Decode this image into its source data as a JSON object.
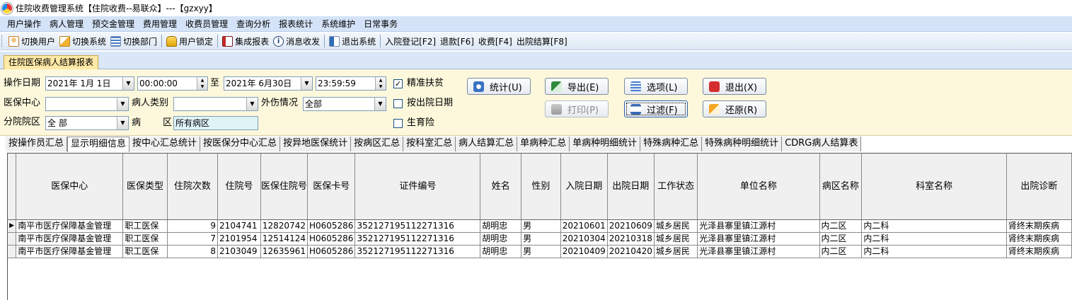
{
  "window": {
    "title": "住院收费管理系统【住院收费--易联众】---【gzxyy】"
  },
  "menu": [
    "用户操作",
    "病人管理",
    "预交金管理",
    "费用管理",
    "收费员管理",
    "查询分析",
    "报表统计",
    "系统维护",
    "日常事务"
  ],
  "toolbar": {
    "switch_user": "切换用户",
    "switch_system": "切换系统",
    "switch_dept": "切换部门",
    "lock_user": "用户锁定",
    "integrated_report": "集成报表",
    "message": "消息收发",
    "exit_system": "退出系统",
    "admission": "入院登记[F2]",
    "refund": "退款[F6]",
    "charge": "收费[F4]",
    "discharge": "出院结算[F8]"
  },
  "doc_tab": "住院医保病人结算报表",
  "filters": {
    "op_date_label": "操作日期",
    "date_from": "2021年 1月 1日",
    "time_from": "00:00:00",
    "to_label": "至",
    "date_to": "2021年 6月30日",
    "time_to": "23:59:59",
    "precise_poverty": {
      "label": "精准扶贫",
      "checked": "✓"
    },
    "by_discharge_date": {
      "label": "按出院日期",
      "checked": ""
    },
    "maternity": {
      "label": "生育险",
      "checked": ""
    },
    "insurance_center_label": "医保中心",
    "insurance_center_value": "",
    "patient_type_label": "病人类别",
    "patient_type_value": "",
    "injury_label": "外伤情况",
    "injury_value": "全部",
    "branch_label": "分院院区",
    "branch_value": "全 部",
    "ward_label_1": "病",
    "ward_label_2": "区",
    "ward_value": "所有病区"
  },
  "buttons": {
    "stat": "统计(U)",
    "export": "导出(E)",
    "options": "选项(L)",
    "exit": "退出(X)",
    "print": "打印(P)",
    "filter": "过滤(F)",
    "restore": "还原(R)"
  },
  "subtabs": [
    "按操作员汇总",
    "显示明细信息",
    "按中心汇总统计",
    "按医保分中心汇总",
    "按异地医保统计",
    "按病区汇总",
    "按科室汇总",
    "病人结算汇总",
    "单病种汇总",
    "单病种明细统计",
    "特殊病种汇总",
    "特殊病种明细统计",
    "CDRG病人结算表"
  ],
  "table": {
    "columns": [
      "医保中心",
      "医保类型",
      "住院次数",
      "住院号",
      "医保住院号",
      "医保卡号",
      "证件编号",
      "姓名",
      "性别",
      "入院日期",
      "出院日期",
      "工作状态",
      "单位名称",
      "病区名称",
      "科室名称",
      "出院诊断"
    ],
    "rows": [
      [
        "南平市医疗保障基金管理",
        "职工医保",
        "9",
        "2104741",
        "12820742",
        "H0605286",
        "352127195112271316",
        "胡明忠",
        "男",
        "20210601",
        "20210609",
        "城乡居民",
        "光泽县寨里镇江源村",
        "内二区",
        "内二科",
        "肾终末期疾病"
      ],
      [
        "南平市医疗保障基金管理",
        "职工医保",
        "7",
        "2101954",
        "12514124",
        "H0605286",
        "352127195112271316",
        "胡明忠",
        "男",
        "20210304",
        "20210318",
        "城乡居民",
        "光泽县寨里镇江源村",
        "内二区",
        "内二科",
        "肾终末期疾病"
      ],
      [
        "南平市医疗保障基金管理",
        "职工医保",
        "8",
        "2103049",
        "12635961",
        "H0605286",
        "352127195112271316",
        "胡明忠",
        "男",
        "20210409",
        "20210420",
        "城乡居民",
        "光泽县寨里镇江源村",
        "内二区",
        "内二科",
        "肾终末期疾病"
      ]
    ],
    "current_row_marker": "▶"
  }
}
